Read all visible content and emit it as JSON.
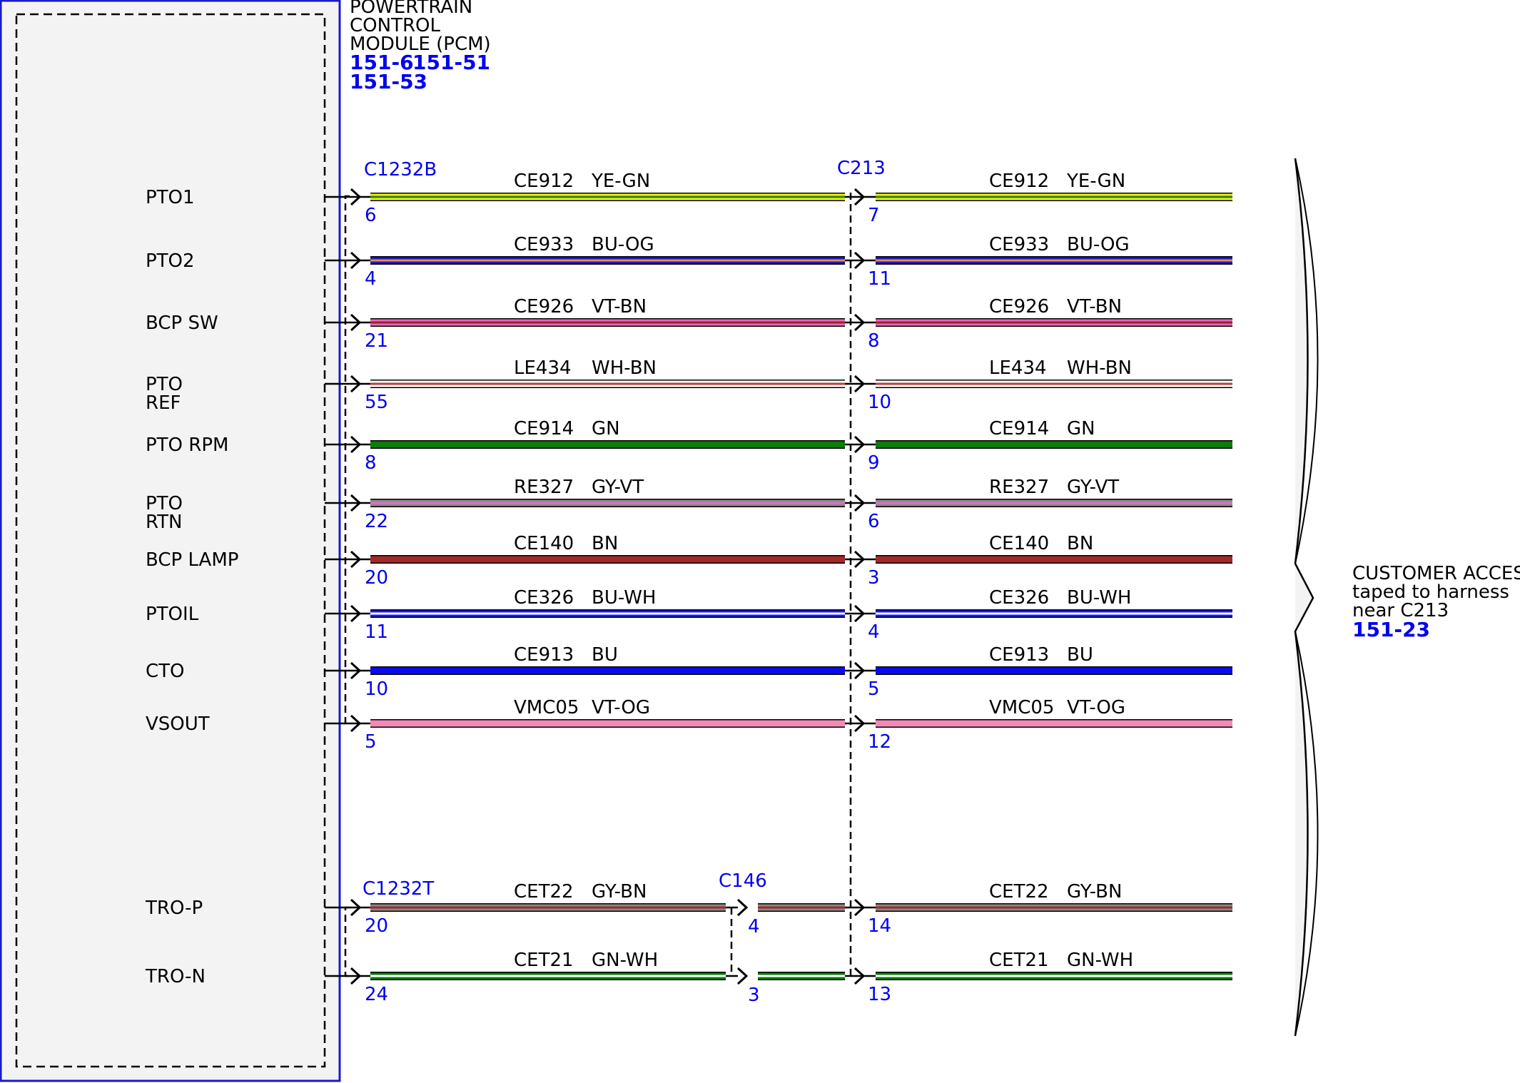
{
  "module": {
    "title_lines": [
      "POWERTRAIN",
      "CONTROL",
      "MODULE (PCM)"
    ],
    "refs_line1": [
      "151-6",
      "151-51"
    ],
    "refs_line2": [
      "151-53"
    ]
  },
  "connectors": {
    "pcm_upper": "C1232B",
    "pcm_lower": "C1232T",
    "inline_right": "C213",
    "inline_mid": "C146"
  },
  "circuits": [
    {
      "signal": [
        "PTO1"
      ],
      "circuit": "CE912",
      "color": "YE-GN",
      "pin_pcm": "6",
      "pin_c213": "7",
      "base": "#f2f200",
      "stripe": "#2e7d32",
      "kind": "stripe"
    },
    {
      "signal": [
        "PTO2"
      ],
      "circuit": "CE933",
      "color": "BU-OG",
      "pin_pcm": "4",
      "pin_c213": "11",
      "base": "#1a1acc",
      "stripe": "#f08a3a",
      "kind": "stripe"
    },
    {
      "signal": [
        "BCP SW"
      ],
      "circuit": "CE926",
      "color": "VT-BN",
      "pin_pcm": "21",
      "pin_c213": "8",
      "base": "#ee66bb",
      "stripe": "#8b2a2a",
      "kind": "stripe"
    },
    {
      "signal": [
        "PTO",
        "REF"
      ],
      "circuit": "LE434",
      "color": "WH-BN",
      "pin_pcm": "55",
      "pin_c213": "10",
      "base": "#ffffff",
      "stripe": "#b04040",
      "kind": "stripe"
    },
    {
      "signal": [
        "PTO RPM"
      ],
      "circuit": "CE914",
      "color": "GN",
      "pin_pcm": "8",
      "pin_c213": "9",
      "base": "#0a7d0a",
      "stripe": "",
      "kind": "solid"
    },
    {
      "signal": [
        "PTO",
        "RTN"
      ],
      "circuit": "RE327",
      "color": "GY-VT",
      "pin_pcm": "22",
      "pin_c213": "6",
      "base": "#8a8a8a",
      "stripe": "#e070c8",
      "kind": "stripe"
    },
    {
      "signal": [
        "BCP LAMP"
      ],
      "circuit": "CE140",
      "color": "BN",
      "pin_pcm": "20",
      "pin_c213": "3",
      "base": "#a02a2a",
      "stripe": "",
      "kind": "solid"
    },
    {
      "signal": [
        "PTOIL"
      ],
      "circuit": "CE326",
      "color": "BU-WH",
      "pin_pcm": "11",
      "pin_c213": "4",
      "base": "#1a1aee",
      "stripe": "#ffffff",
      "kind": "stripe"
    },
    {
      "signal": [
        "CTO"
      ],
      "circuit": "CE913",
      "color": "BU",
      "pin_pcm": "10",
      "pin_c213": "5",
      "base": "#0a0aee",
      "stripe": "",
      "kind": "solid"
    },
    {
      "signal": [
        "VSOUT"
      ],
      "circuit": "VMC05",
      "color": "VT-OG",
      "pin_pcm": "5",
      "pin_c213": "12",
      "base": "#f28ab8",
      "stripe": "",
      "kind": "solid"
    },
    {
      "signal": [
        "TRO-P"
      ],
      "circuit": "CET22",
      "color": "GY-BN",
      "pin_pcm": "20",
      "pin_c146": "4",
      "pin_c213": "14",
      "base": "#8a8a8a",
      "stripe": "#a02a2a",
      "kind": "stripe"
    },
    {
      "signal": [
        "TRO-N"
      ],
      "circuit": "CET21",
      "color": "GN-WH",
      "pin_pcm": "24",
      "pin_c146": "3",
      "pin_c213": "13",
      "base": "#0a7d0a",
      "stripe": "#ffffff",
      "kind": "stripe"
    }
  ],
  "customer_access": {
    "lines": [
      "CUSTOMER ACCESS",
      "taped to harness",
      "near C213"
    ],
    "ref": "151-23"
  }
}
